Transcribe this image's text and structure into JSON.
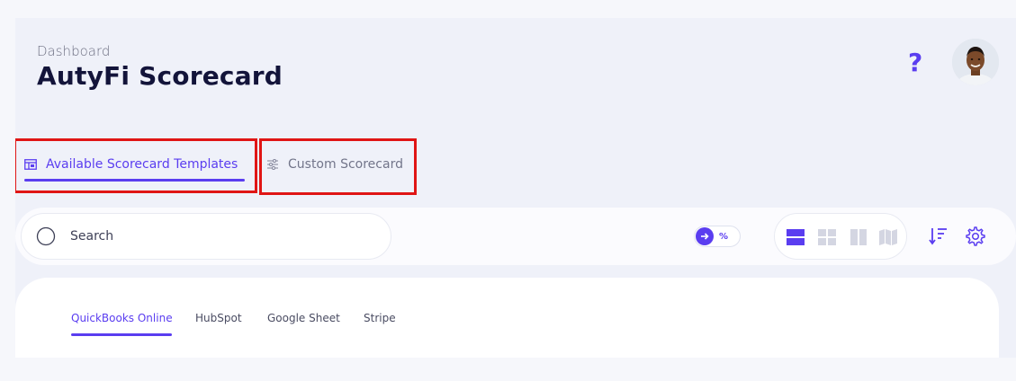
{
  "header": {
    "breadcrumb": "Dashboard",
    "title": "AutyFi Scorecard",
    "help_label": "?"
  },
  "tabs": {
    "available": "Available Scorecard Templates",
    "custom": "Custom Scorecard"
  },
  "toolbar": {
    "search_placeholder": "Search",
    "toggle_label": "%",
    "views": [
      "list-view",
      "grid-view",
      "columns-view",
      "map-view"
    ],
    "tools": [
      "sort-icon",
      "settings-icon"
    ]
  },
  "integrations": {
    "tabs": [
      "QuickBooks Online",
      "HubSpot",
      "Google Sheet",
      "Stripe"
    ],
    "active": "QuickBooks Online"
  },
  "colors": {
    "accent": "#5a3df0",
    "highlight": "#e01515",
    "title": "#13143a"
  }
}
